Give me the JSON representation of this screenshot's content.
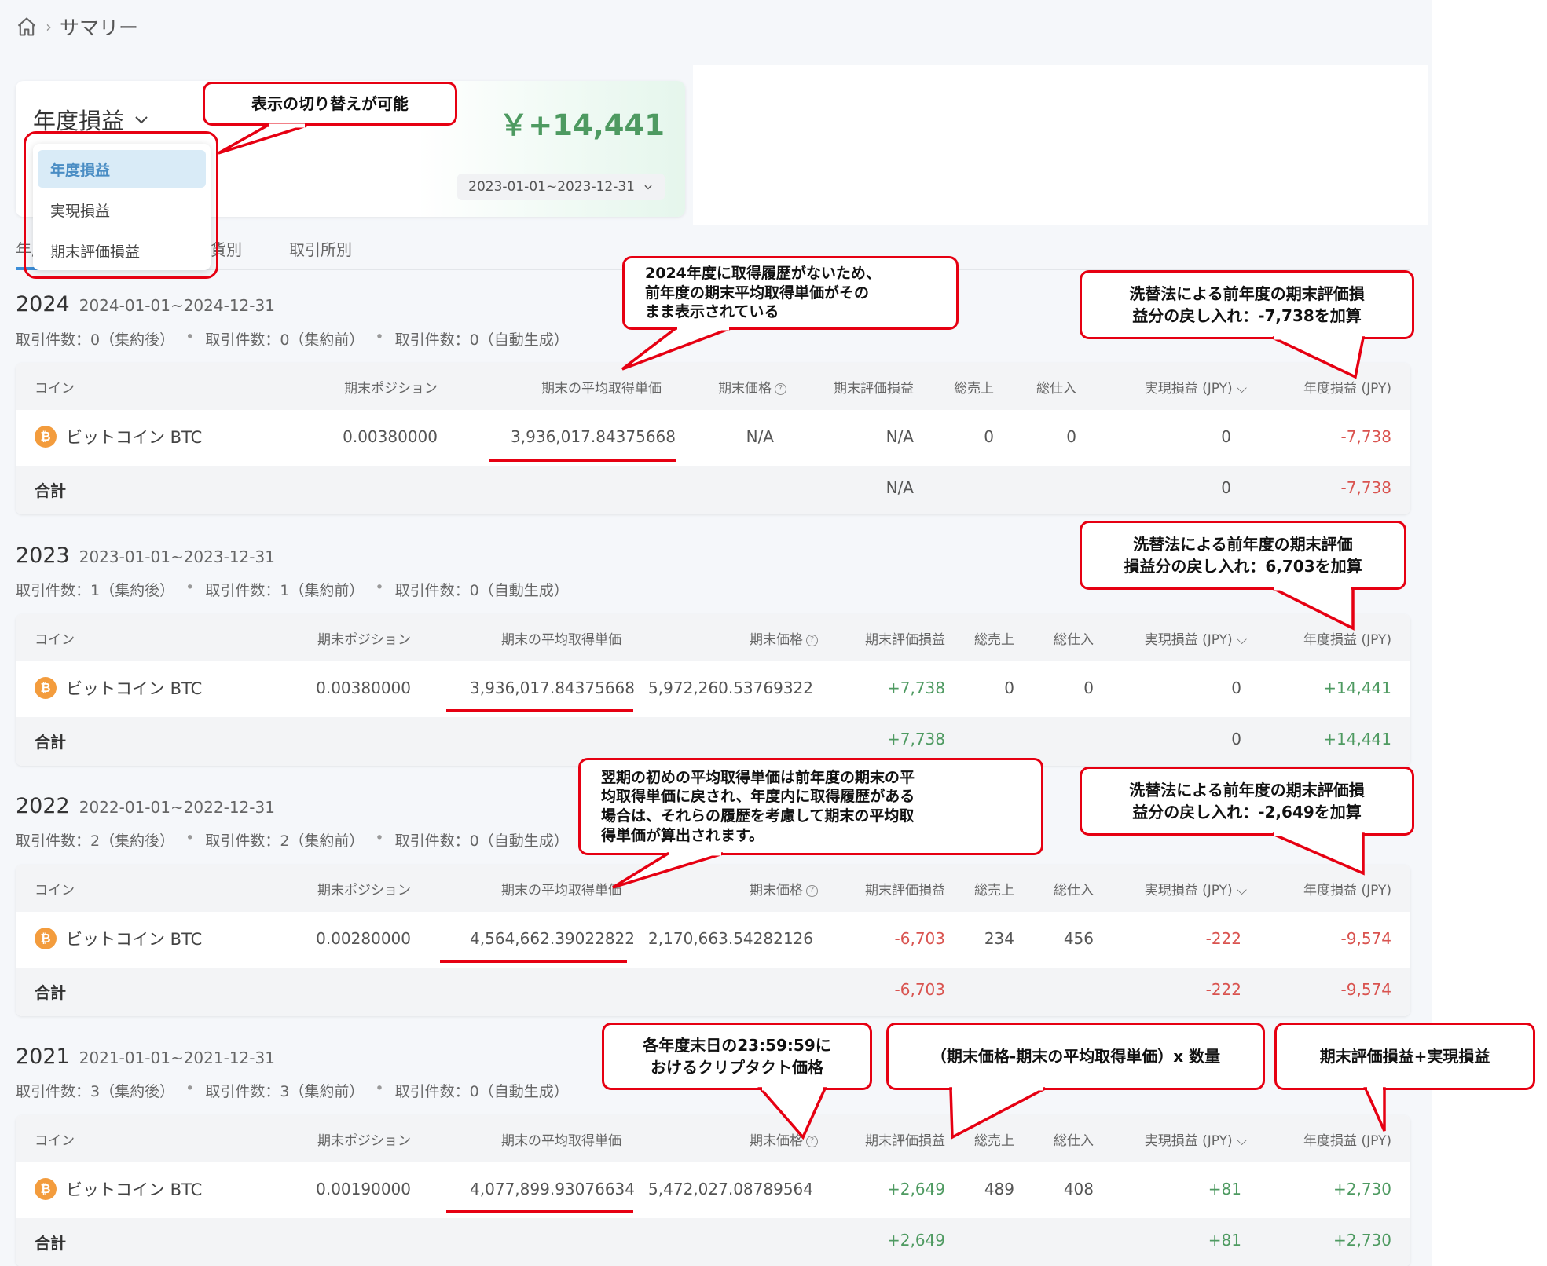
{
  "breadcrumb": {
    "current": "サマリー"
  },
  "summary": {
    "title": "年度損益",
    "amount": "￥+14,441",
    "date_range": "2023-01-01~2023-12-31"
  },
  "dropdown": {
    "options": [
      "年度損益",
      "実現損益",
      "期末評価損益"
    ]
  },
  "tabs": [
    "年度別",
    "通貨別",
    "取引所別"
  ],
  "columns": {
    "coin": "コイン",
    "position": "期末ポジション",
    "avg_cost": "期末の平均取得単価",
    "price": "期末価格",
    "unrealized": "期末評価損益",
    "sales": "総売上",
    "purchases": "総仕入",
    "realized": "実現損益 (JPY)",
    "annual": "年度損益 (JPY)"
  },
  "coin_name": "ビットコイン BTC",
  "total_label": "合計",
  "years": [
    {
      "year": "2024",
      "range": "2024-01-01~2024-12-31",
      "counts": [
        "取引件数：0（集約後）",
        "取引件数：0（集約前）",
        "取引件数：0（自動生成）"
      ],
      "row": {
        "position": "0.00380000",
        "avg_cost": "3,936,017.84375668",
        "price": "N/A",
        "unrealized": "N/A",
        "sales": "0",
        "purchases": "0",
        "realized": "0",
        "annual": "-7,738"
      },
      "total": {
        "unrealized": "N/A",
        "realized": "0",
        "annual": "-7,738"
      }
    },
    {
      "year": "2023",
      "range": "2023-01-01~2023-12-31",
      "counts": [
        "取引件数：1（集約後）",
        "取引件数：1（集約前）",
        "取引件数：0（自動生成）"
      ],
      "row": {
        "position": "0.00380000",
        "avg_cost": "3,936,017.84375668",
        "price": "5,972,260.53769322",
        "unrealized": "+7,738",
        "sales": "0",
        "purchases": "0",
        "realized": "0",
        "annual": "+14,441"
      },
      "total": {
        "unrealized": "+7,738",
        "realized": "0",
        "annual": "+14,441"
      }
    },
    {
      "year": "2022",
      "range": "2022-01-01~2022-12-31",
      "counts": [
        "取引件数：2（集約後）",
        "取引件数：2（集約前）",
        "取引件数：0（自動生成）"
      ],
      "row": {
        "position": "0.00280000",
        "avg_cost": "4,564,662.39022822",
        "price": "2,170,663.54282126",
        "unrealized": "-6,703",
        "sales": "234",
        "purchases": "456",
        "realized": "-222",
        "annual": "-9,574"
      },
      "total": {
        "unrealized": "-6,703",
        "realized": "-222",
        "annual": "-9,574"
      }
    },
    {
      "year": "2021",
      "range": "2021-01-01~2021-12-31",
      "counts": [
        "取引件数：3（集約後）",
        "取引件数：3（集約前）",
        "取引件数：0（自動生成）"
      ],
      "row": {
        "position": "0.00190000",
        "avg_cost": "4,077,899.93076634",
        "price": "5,472,027.08789564",
        "unrealized": "+2,649",
        "sales": "489",
        "purchases": "408",
        "realized": "+81",
        "annual": "+2,730"
      },
      "total": {
        "unrealized": "+2,649",
        "realized": "+81",
        "annual": "+2,730"
      }
    }
  ],
  "callouts": {
    "switch": "表示の切り替えが可能",
    "no_history": [
      "2024年度に取得履歴がないため、",
      "前年度の期末平均取得単価がその",
      "まま表示されている"
    ],
    "reversal_2024": [
      "洗替法による前年度の期末評価損",
      "益分の戻し入れ：-7,738を加算"
    ],
    "reversal_2023": [
      "洗替法による前年度の期末評価",
      "損益分の戻し入れ：6,703を加算"
    ],
    "next_period": [
      "翌期の初めの平均取得単価は前年度の期末の平",
      "均取得単価に戻され、年度内に取得履歴がある",
      "場合は、それらの履歴を考慮して期末の平均取",
      "得単価が算出されます。"
    ],
    "reversal_2022": [
      "洗替法による前年度の期末評価損",
      "益分の戻し入れ：-2,649を加算"
    ],
    "price_note": [
      "各年度末日の23:59:59に",
      "おけるクリプタクト価格"
    ],
    "formula": "（期末価格-期末の平均取得単価）x 数量",
    "annual_formula": "期末評価損益+実現損益"
  }
}
